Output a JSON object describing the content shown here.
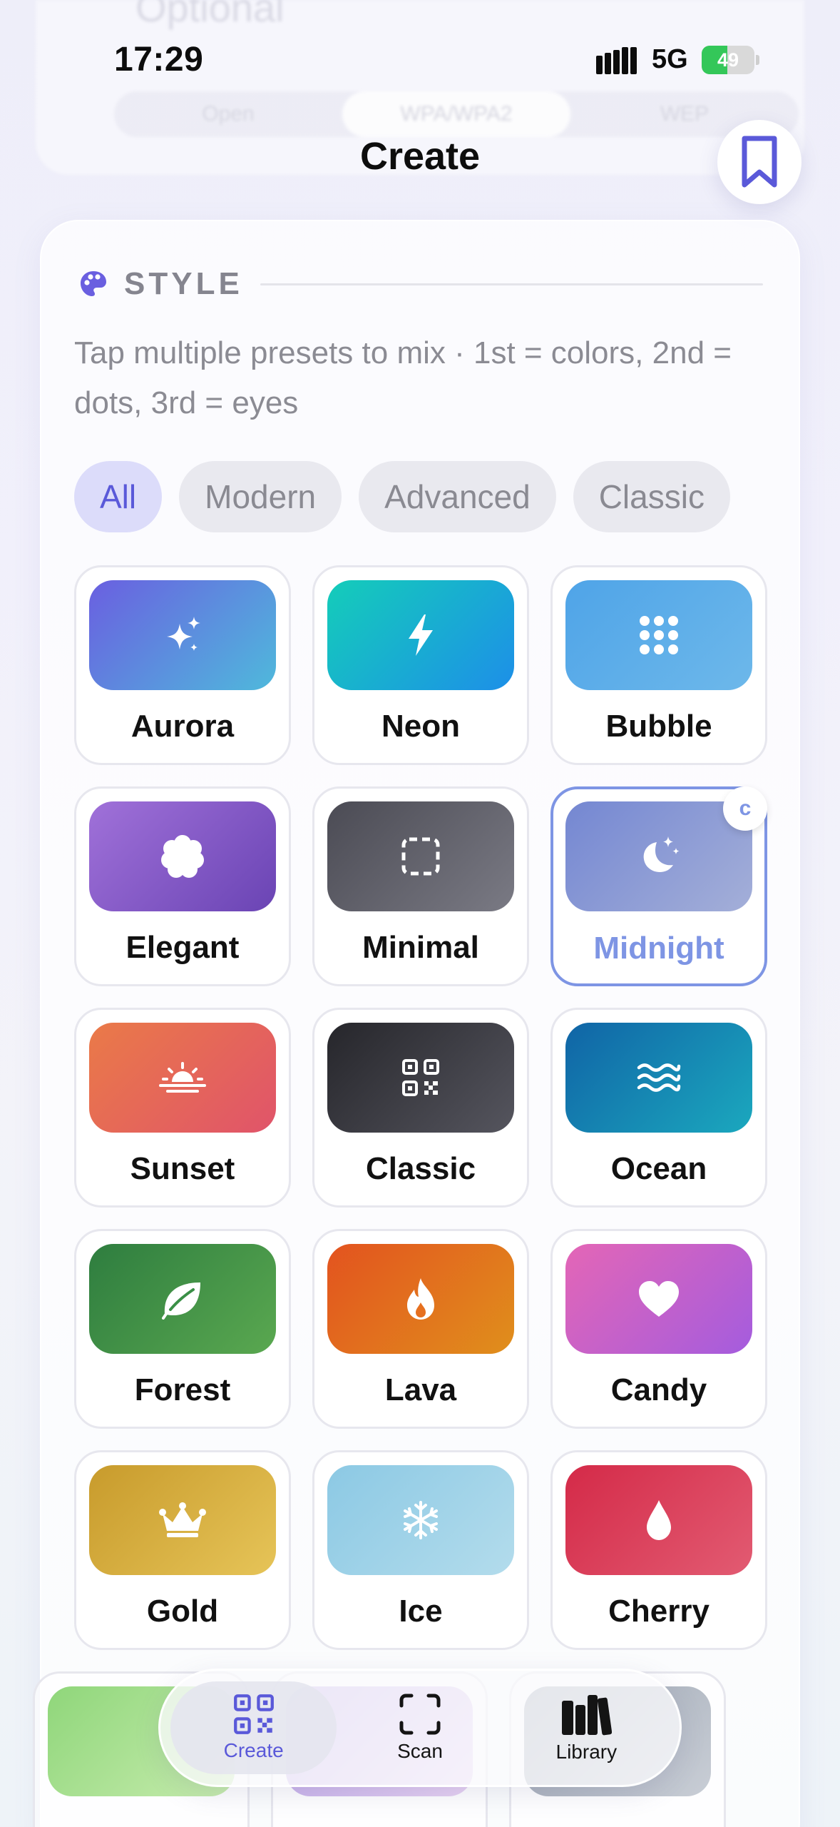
{
  "background_ghost": {
    "text": "Optional",
    "segments": [
      "Open",
      "WPA/WPA2",
      "WEP"
    ]
  },
  "status_bar": {
    "time": "17:29",
    "network": "5G",
    "battery": "49",
    "battery_level": 0.49,
    "battery_color": "#34c759"
  },
  "header": {
    "title": "Create",
    "bookmark_icon": "bookmark-icon"
  },
  "style_section": {
    "icon": "palette-icon",
    "title": "STYLE",
    "description": "Tap multiple presets to mix · 1st = colors, 2nd = dots, 3rd = eyes",
    "filters": [
      {
        "label": "All",
        "active": true
      },
      {
        "label": "Modern",
        "active": false
      },
      {
        "label": "Advanced",
        "active": false
      },
      {
        "label": "Classic",
        "active": false
      }
    ],
    "presets": [
      {
        "label": "Aurora",
        "icon": "sparkles-icon",
        "gradient": [
          "#6a5fe0",
          "#4fb9dc"
        ]
      },
      {
        "label": "Neon",
        "icon": "bolt-icon",
        "gradient": [
          "#14cdb9",
          "#1d8fe8"
        ]
      },
      {
        "label": "Bubble",
        "icon": "dots-grid-icon",
        "gradient": [
          "#4fa4e8",
          "#6db8ea"
        ]
      },
      {
        "label": "Elegant",
        "icon": "flower-badge-icon",
        "gradient": [
          "#a071d9",
          "#6a44b4"
        ]
      },
      {
        "label": "Minimal",
        "icon": "dashed-square-icon",
        "gradient": [
          "#4b4b54",
          "#7a7a84"
        ]
      },
      {
        "label": "Midnight",
        "icon": "moon-stars-icon",
        "gradient": [
          "#7487d2",
          "#a4afd8"
        ],
        "selected": true,
        "badge": "c"
      },
      {
        "label": "Sunset",
        "icon": "sunrise-icon",
        "gradient": [
          "#ea7a48",
          "#e0546a"
        ]
      },
      {
        "label": "Classic",
        "icon": "qr-code-icon",
        "gradient": [
          "#26262b",
          "#55555e"
        ]
      },
      {
        "label": "Ocean",
        "icon": "waves-icon",
        "gradient": [
          "#1064a6",
          "#1ba8be"
        ]
      },
      {
        "label": "Forest",
        "icon": "leaf-icon",
        "gradient": [
          "#2e7d3f",
          "#5aa850"
        ]
      },
      {
        "label": "Lava",
        "icon": "flame-icon",
        "gradient": [
          "#e3531f",
          "#e08f1c"
        ]
      },
      {
        "label": "Candy",
        "icon": "heart-icon",
        "gradient": [
          "#e466b6",
          "#a45cde"
        ]
      },
      {
        "label": "Gold",
        "icon": "crown-icon",
        "gradient": [
          "#c89b2c",
          "#e6c458"
        ]
      },
      {
        "label": "Ice",
        "icon": "snowflake-icon",
        "gradient": [
          "#8cc9e4",
          "#b3dcec"
        ]
      },
      {
        "label": "Cherry",
        "icon": "drop-icon",
        "gradient": [
          "#d42a48",
          "#e25b72"
        ]
      }
    ],
    "partial_row_colors": [
      [
        "#8fd67a",
        "#c7ecae"
      ],
      [
        "#b9a3e6",
        "#e7d2f2"
      ],
      [
        "#9aa3b0",
        "#c9ced6"
      ]
    ]
  },
  "tab_bar": {
    "tabs": [
      {
        "label": "Create",
        "icon": "qr-code-icon",
        "active": true
      },
      {
        "label": "Scan",
        "icon": "scan-frame-icon",
        "active": false
      },
      {
        "label": "Library",
        "icon": "books-icon",
        "active": false
      }
    ]
  },
  "accent_color": "#5a59d9"
}
